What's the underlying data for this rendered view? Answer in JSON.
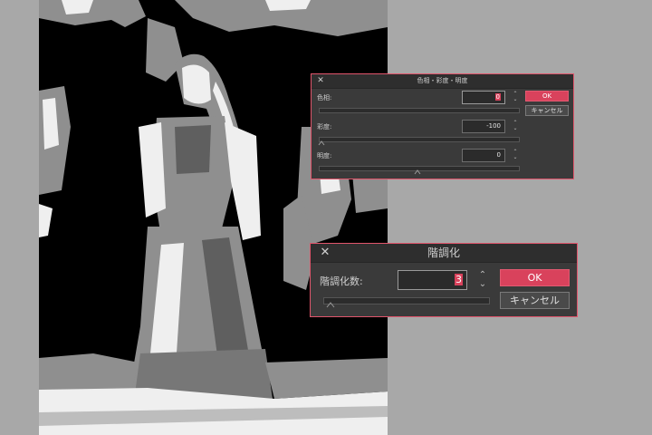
{
  "hsv_dialog": {
    "title": "色相・彩度・明度",
    "hue_label": "色相:",
    "hue_value": "0",
    "saturation_label": "彩度:",
    "saturation_value": "-100",
    "brightness_label": "明度:",
    "brightness_value": "0",
    "ok_label": "OK",
    "cancel_label": "キャンセル"
  },
  "posterize_dialog": {
    "title": "階調化",
    "levels_label": "階調化数:",
    "levels_value": "3",
    "ok_label": "OK",
    "cancel_label": "キャンセル"
  },
  "colors": {
    "accent": "#d9425c",
    "dialog_bg": "#3a3a3a",
    "workspace": "#a8a8a8"
  },
  "icons": {
    "close": "close-icon",
    "spinner": "spinner-icon",
    "slider_thumb": "slider-thumb-icon"
  }
}
